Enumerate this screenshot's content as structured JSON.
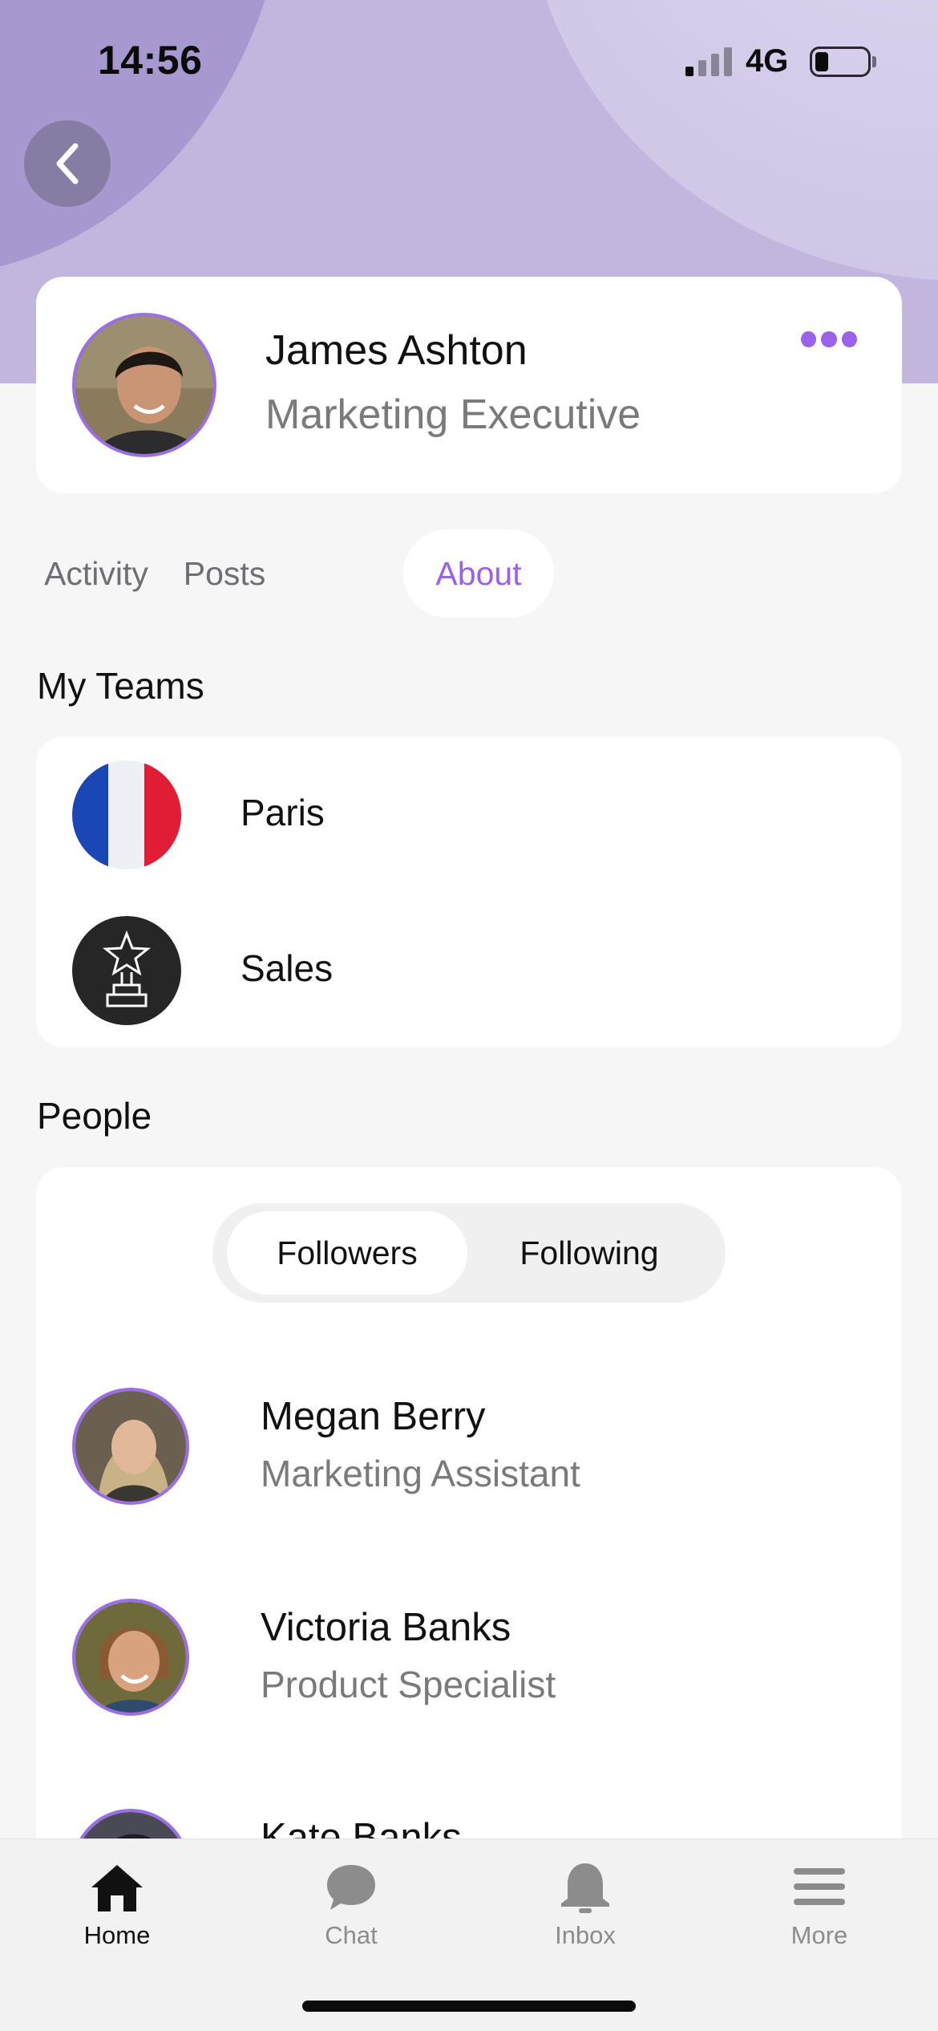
{
  "status_bar": {
    "time": "14:56",
    "network": "4G"
  },
  "profile": {
    "name": "James Ashton",
    "role": "Marketing Executive",
    "accent_color": "#9b61ea"
  },
  "tabs": [
    {
      "label": "Activity",
      "active": false
    },
    {
      "label": "Posts",
      "active": false
    },
    {
      "label": "About",
      "active": true
    }
  ],
  "teams": {
    "title": "My Teams",
    "items": [
      {
        "name": "Paris",
        "icon": "france-flag-icon"
      },
      {
        "name": "Sales",
        "icon": "trophy-icon"
      }
    ]
  },
  "people": {
    "title": "People",
    "segments": [
      {
        "label": "Followers",
        "active": true
      },
      {
        "label": "Following",
        "active": false
      }
    ],
    "items": [
      {
        "name": "Megan Berry",
        "role": "Marketing Assistant"
      },
      {
        "name": "Victoria Banks",
        "role": "Product Specialist"
      },
      {
        "name": "Kate Banks",
        "role": ""
      }
    ]
  },
  "tabbar": [
    {
      "label": "Home",
      "icon": "home-icon",
      "active": true
    },
    {
      "label": "Chat",
      "icon": "chat-icon",
      "active": false
    },
    {
      "label": "Inbox",
      "icon": "bell-icon",
      "active": false
    },
    {
      "label": "More",
      "icon": "menu-icon",
      "active": false
    }
  ]
}
